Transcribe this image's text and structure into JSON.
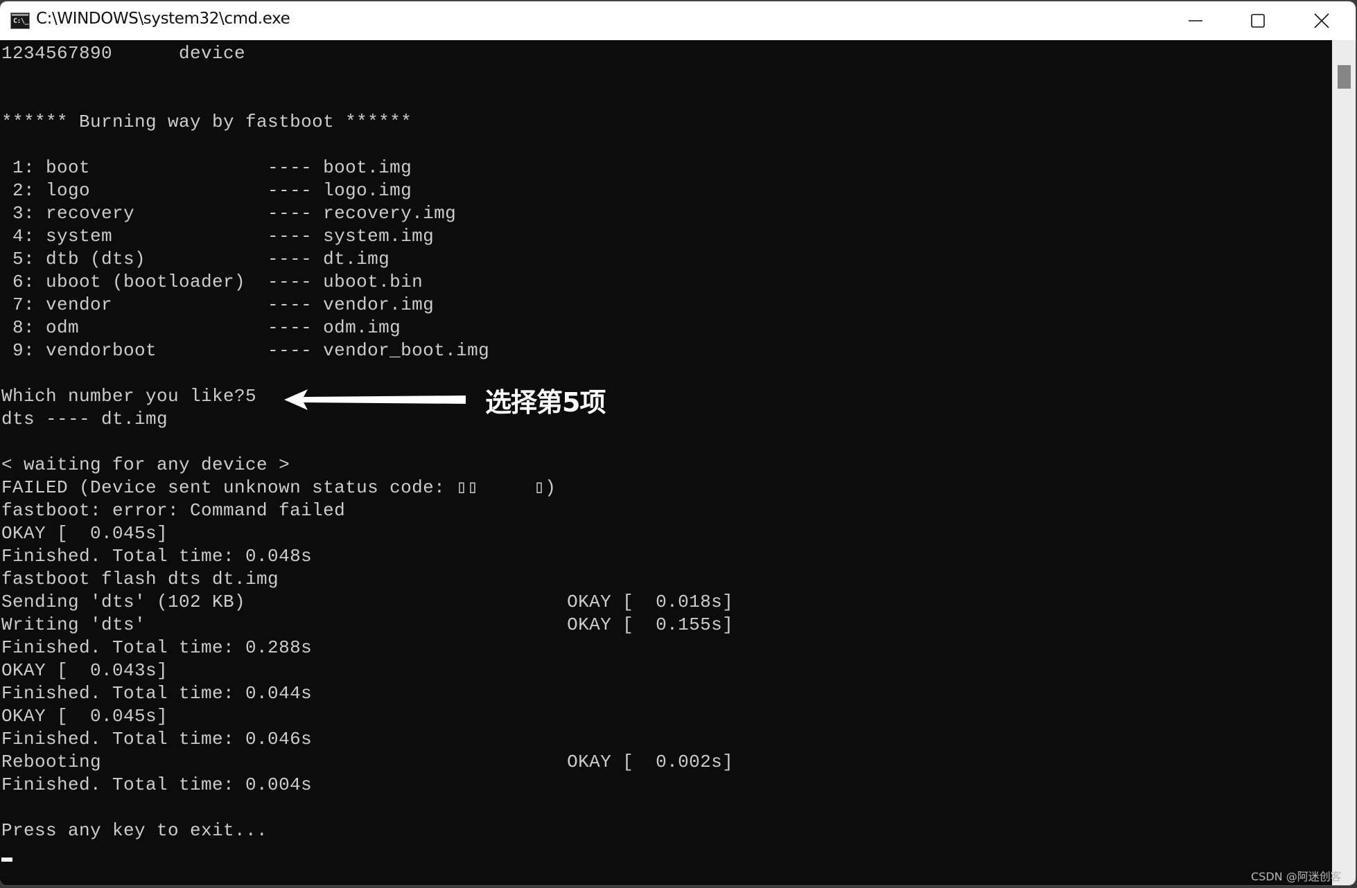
{
  "window": {
    "title": "C:\\WINDOWS\\system32\\cmd.exe",
    "icon": "cmd-icon",
    "icon_glyph": "C:\\_",
    "controls": {
      "minimize": "minimize-icon",
      "maximize": "maximize-icon",
      "close": "close-icon"
    }
  },
  "console": {
    "lines": [
      "1234567890      device",
      "",
      "",
      "****** Burning way by fastboot ******",
      "",
      " 1: boot                ---- boot.img",
      " 2: logo                ---- logo.img",
      " 3: recovery            ---- recovery.img",
      " 4: system              ---- system.img",
      " 5: dtb (dts)           ---- dt.img",
      " 6: uboot (bootloader)  ---- uboot.bin",
      " 7: vendor              ---- vendor.img",
      " 8: odm                 ---- odm.img",
      " 9: vendorboot          ---- vendor_boot.img",
      "",
      "Which number you like?5",
      "dts ---- dt.img",
      "",
      "< waiting for any device >",
      "FAILED (Device sent unknown status code: ▯▯     ▯)",
      "fastboot: error: Command failed",
      "OKAY [  0.045s]",
      "Finished. Total time: 0.048s",
      "fastboot flash dts dt.img",
      "Sending 'dts' (102 KB)                             OKAY [  0.018s]",
      "Writing 'dts'                                      OKAY [  0.155s]",
      "Finished. Total time: 0.288s",
      "OKAY [  0.043s]",
      "Finished. Total time: 0.044s",
      "OKAY [  0.045s]",
      "Finished. Total time: 0.046s",
      "Rebooting                                          OKAY [  0.002s]",
      "Finished. Total time: 0.004s",
      "",
      "Press any key to exit...",
      ""
    ]
  },
  "annotation": {
    "text": "选择第5项",
    "arrow": "arrow-left-icon",
    "color": "#ffffff"
  },
  "watermark": "CSDN @阿迷创客",
  "colors": {
    "console_bg": "#0c0c0c",
    "console_fg": "#cccccc",
    "titlebar_bg": "#ffffff",
    "scrollbar_bg": "#ececec",
    "scrollbar_thumb": "#868686"
  }
}
